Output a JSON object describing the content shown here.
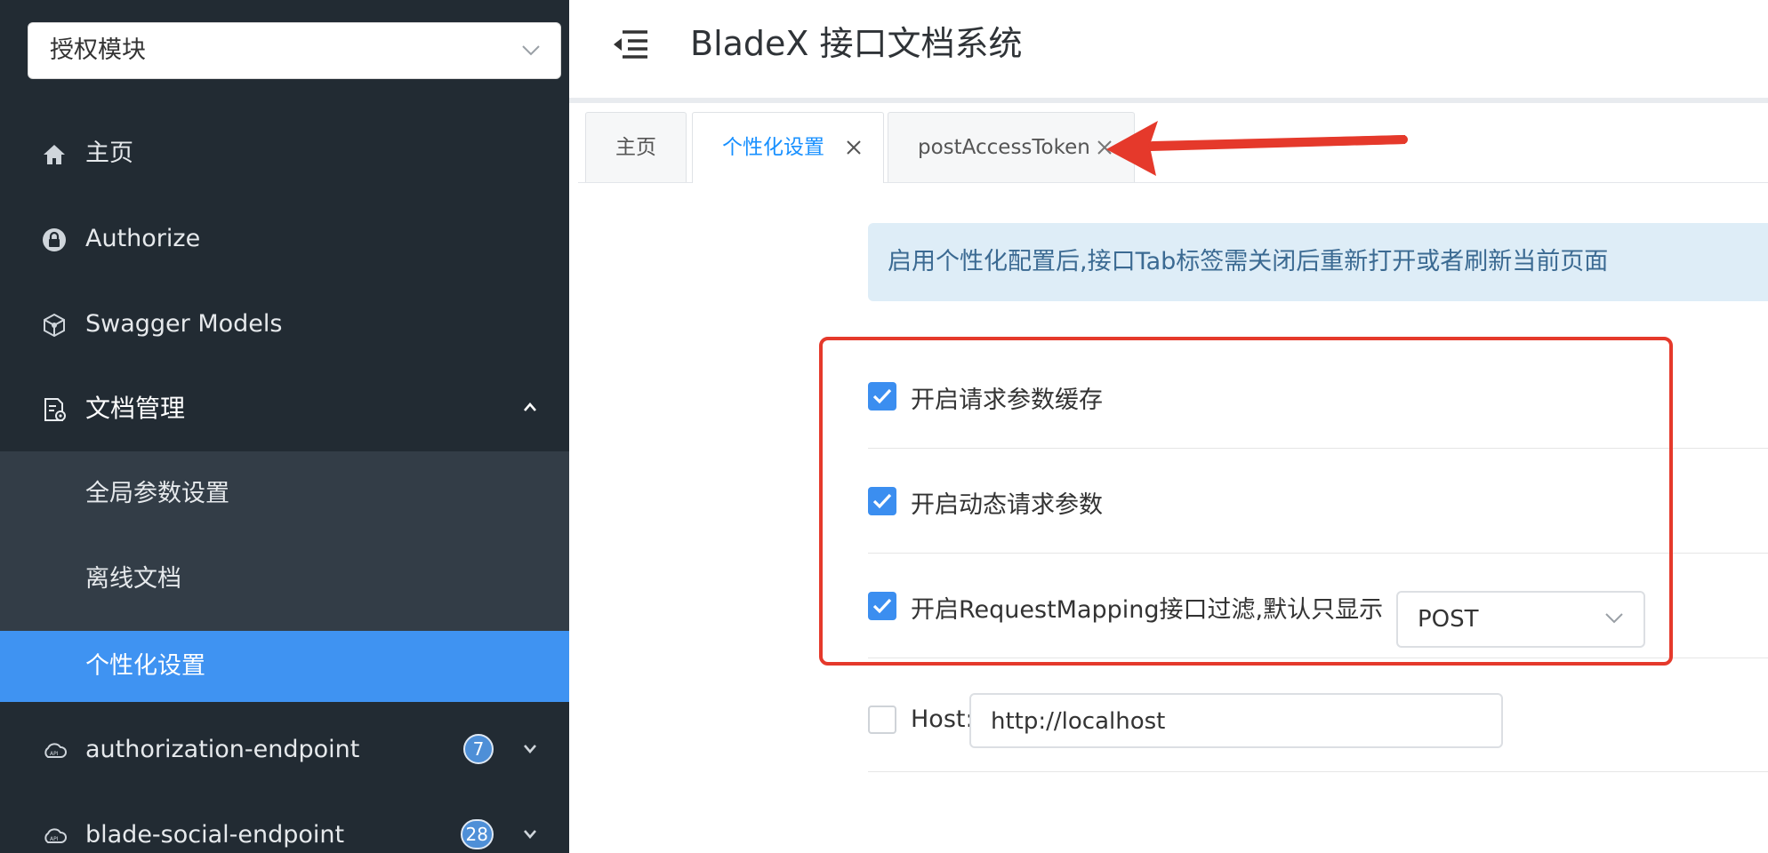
{
  "sidebar": {
    "group_select": "授权模块",
    "items": [
      {
        "label": "主页",
        "icon": "home-icon"
      },
      {
        "label": "Authorize",
        "icon": "lock-icon"
      },
      {
        "label": "Swagger Models",
        "icon": "cube-icon"
      },
      {
        "label": "文档管理",
        "icon": "document-settings-icon"
      }
    ],
    "subitems": [
      {
        "label": "全局参数设置"
      },
      {
        "label": "离线文档"
      },
      {
        "label": "个性化设置"
      }
    ],
    "endpoints": [
      {
        "label": "authorization-endpoint",
        "count": "7",
        "icon": "cloud-api-icon"
      },
      {
        "label": "blade-social-endpoint",
        "count": "28",
        "icon": "cloud-api-icon"
      }
    ]
  },
  "header": {
    "title": "BladeX 接口文档系统"
  },
  "tabs": [
    {
      "label": "主页"
    },
    {
      "label": "个性化设置",
      "close": "X"
    },
    {
      "label": "postAccessToken",
      "close": "X"
    }
  ],
  "settings": {
    "notice": "启用个性化配置后,接口Tab标签需关闭后重新打开或者刷新当前页面",
    "options": [
      {
        "label": "开启请求参数缓存",
        "checked": true
      },
      {
        "label": "开启动态请求参数",
        "checked": true
      },
      {
        "label": "开启RequestMapping接口过滤,默认只显示",
        "checked": true,
        "select_value": "POST"
      }
    ],
    "host": {
      "label": "Host:",
      "value": "http://localhost",
      "checked": false
    }
  },
  "colors": {
    "sidebar_bg": "#222b33",
    "active_blue": "#3f93f2",
    "highlight_red": "#e5392b"
  }
}
